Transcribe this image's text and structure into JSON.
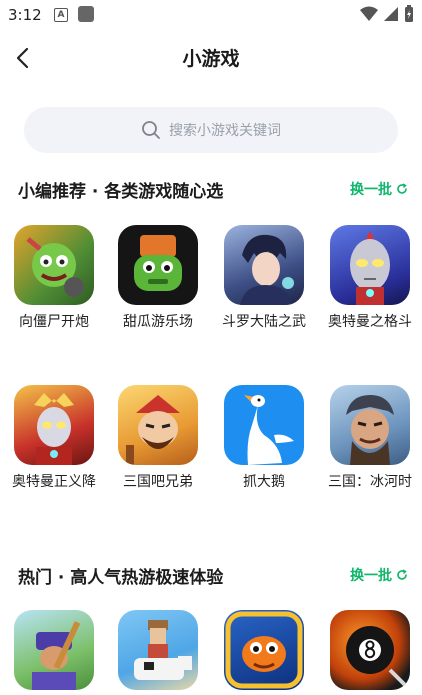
{
  "status_bar": {
    "time": "3:12",
    "a_icon_text": "A"
  },
  "nav": {
    "title": "小游戏"
  },
  "search": {
    "placeholder": "搜索小游戏关键词"
  },
  "section1": {
    "title": "小编推荐 · 各类游戏随心选",
    "refresh_label": "换一批",
    "games": [
      {
        "name": "向僵尸开炮",
        "icon": "zombie-cannon-game-icon",
        "color": "#5b8f3c"
      },
      {
        "name": "甜瓜游乐场",
        "icon": "melon-playground-game-icon",
        "color": "#161616"
      },
      {
        "name": "斗罗大陆之武",
        "icon": "douluo-game-icon",
        "color": "#3c4f8c"
      },
      {
        "name": "奥特曼之格斗",
        "icon": "ultraman-fight-game-icon",
        "color": "#3a46b8"
      },
      {
        "name": "奥特曼正义降",
        "icon": "ultraman-justice-game-icon",
        "color": "#c23a2a"
      },
      {
        "name": "三国吧兄弟",
        "icon": "three-kingdoms-brothers-game-icon",
        "color": "#e7a23a"
      },
      {
        "name": "抓大鹅",
        "icon": "goose-game-icon",
        "color": "#1e8ff0"
      },
      {
        "name": "三国：冰河时",
        "icon": "three-kingdoms-ice-age-game-icon",
        "color": "#7da4c8"
      }
    ]
  },
  "section2": {
    "title": "热门 · 高人气热游极速体验",
    "refresh_label": "换一批",
    "games": [
      {
        "icon": "baseball-game-icon",
        "color": "#7cc06a"
      },
      {
        "icon": "cow-rider-game-icon",
        "color": "#4fa6e6"
      },
      {
        "icon": "fish-game-icon",
        "color": "#f07a1c"
      },
      {
        "icon": "billiards-8ball-game-icon",
        "color": "#1a1a1a"
      }
    ]
  },
  "colors": {
    "accent": "#10b66c",
    "search_bg": "#f1f3f8"
  }
}
